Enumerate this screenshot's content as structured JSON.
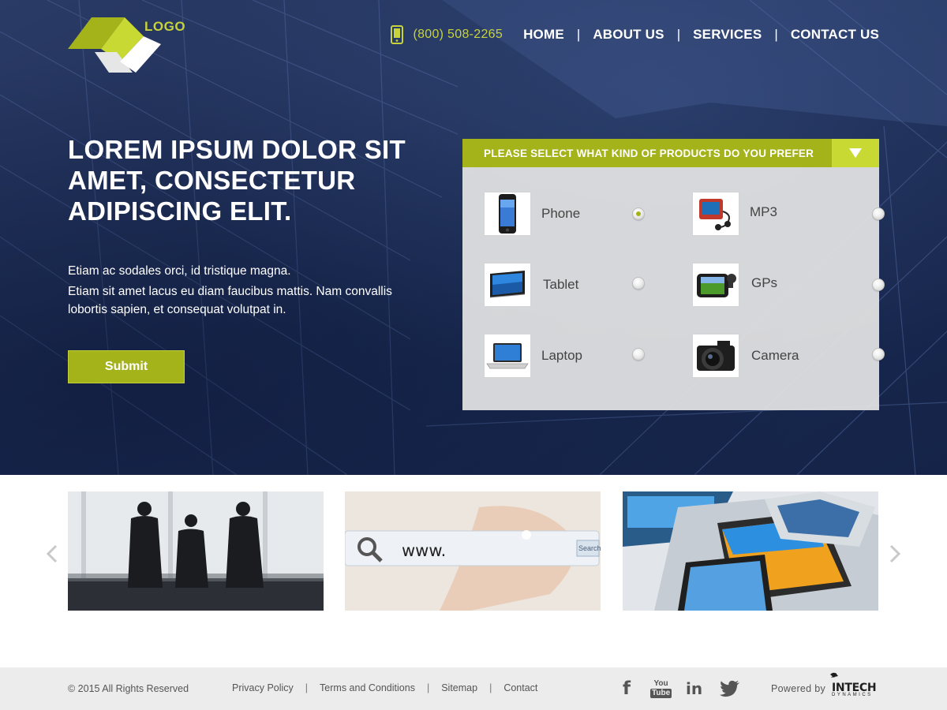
{
  "header": {
    "logo_text": "LOGO",
    "phone": "(800) 508-2265",
    "nav": [
      "HOME",
      "ABOUT US",
      "SERVICES",
      "CONTACT US"
    ]
  },
  "hero": {
    "headline_lines": [
      "LOREM IPSUM DOLOR SIT",
      "AMET, CONSECTETUR",
      "ADIPISCING ELIT."
    ],
    "paragraph1": "Etiam ac sodales orci, id tristique magna.",
    "paragraph2": "Etiam sit amet lacus eu diam faucibus mattis. Nam convallis lobortis sapien, et consequat volutpat in.",
    "submit_label": "Submit"
  },
  "product_panel": {
    "title": "PLEASE SELECT WHAT KIND OF PRODUCTS DO YOU PREFER",
    "options": [
      {
        "label": "Phone",
        "icon": "phone-product-icon",
        "selected": true
      },
      {
        "label": "MP3",
        "icon": "mp3-player-icon",
        "selected": false
      },
      {
        "label": "Tablet",
        "icon": "tablet-icon",
        "selected": false
      },
      {
        "label": "GPs",
        "icon": "gps-device-icon",
        "selected": false
      },
      {
        "label": "Laptop",
        "icon": "laptop-icon",
        "selected": false
      },
      {
        "label": "Camera",
        "icon": "camera-icon",
        "selected": false
      }
    ]
  },
  "carousel": {
    "cards": [
      {
        "name": "business-meeting-image"
      },
      {
        "name": "web-search-image",
        "search_text": "www.",
        "search_button": "Search"
      },
      {
        "name": "devices-image"
      }
    ]
  },
  "footer": {
    "copyright": "© 2015 All Rights Reserved",
    "links": [
      "Privacy Policy",
      "Terms and Conditions",
      "Sitemap",
      "Contact"
    ],
    "social": [
      "facebook-icon",
      "youtube-icon",
      "linkedin-icon",
      "twitter-icon"
    ],
    "youtube_top": "You",
    "youtube_bottom": "Tube",
    "linkedin_text": "in",
    "facebook_text": "f",
    "powered_by": "Powered by",
    "brand_name": "INTECH",
    "brand_sub": "DYNAMICS"
  },
  "colors": {
    "accent": "#a5b31b",
    "accent_light": "#c9d934",
    "hero_bg": "#1b2b52"
  }
}
